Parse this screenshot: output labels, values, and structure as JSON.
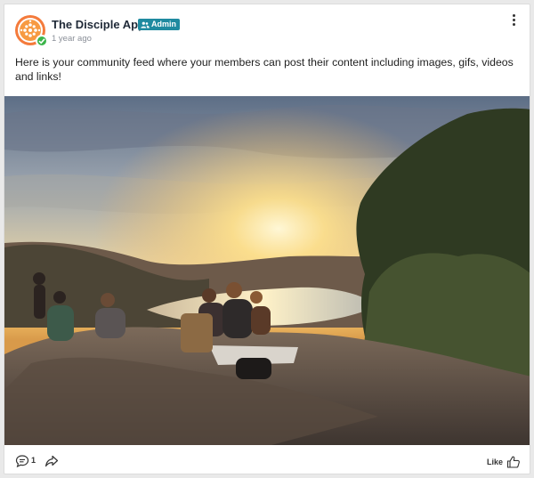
{
  "post": {
    "author": "The Disciple App",
    "badge": "Admin",
    "time": "1 year ago",
    "text": "Here is your community feed where your members can post their content including images, gifs, videos and links!"
  },
  "footer": {
    "comment_count": "1",
    "like_label": "Like"
  },
  "icons": {
    "avatar": "orange-dots-logo",
    "verified": "check-badge-icon",
    "badge": "users-icon",
    "menu": "kebab-menu-icon",
    "comment": "comment-icon",
    "share": "share-arrow-icon",
    "like": "thumbs-up-icon"
  },
  "colors": {
    "brand": "#f47b3c",
    "admin_badge": "#1f8aa0",
    "verified": "#3bb54a"
  }
}
